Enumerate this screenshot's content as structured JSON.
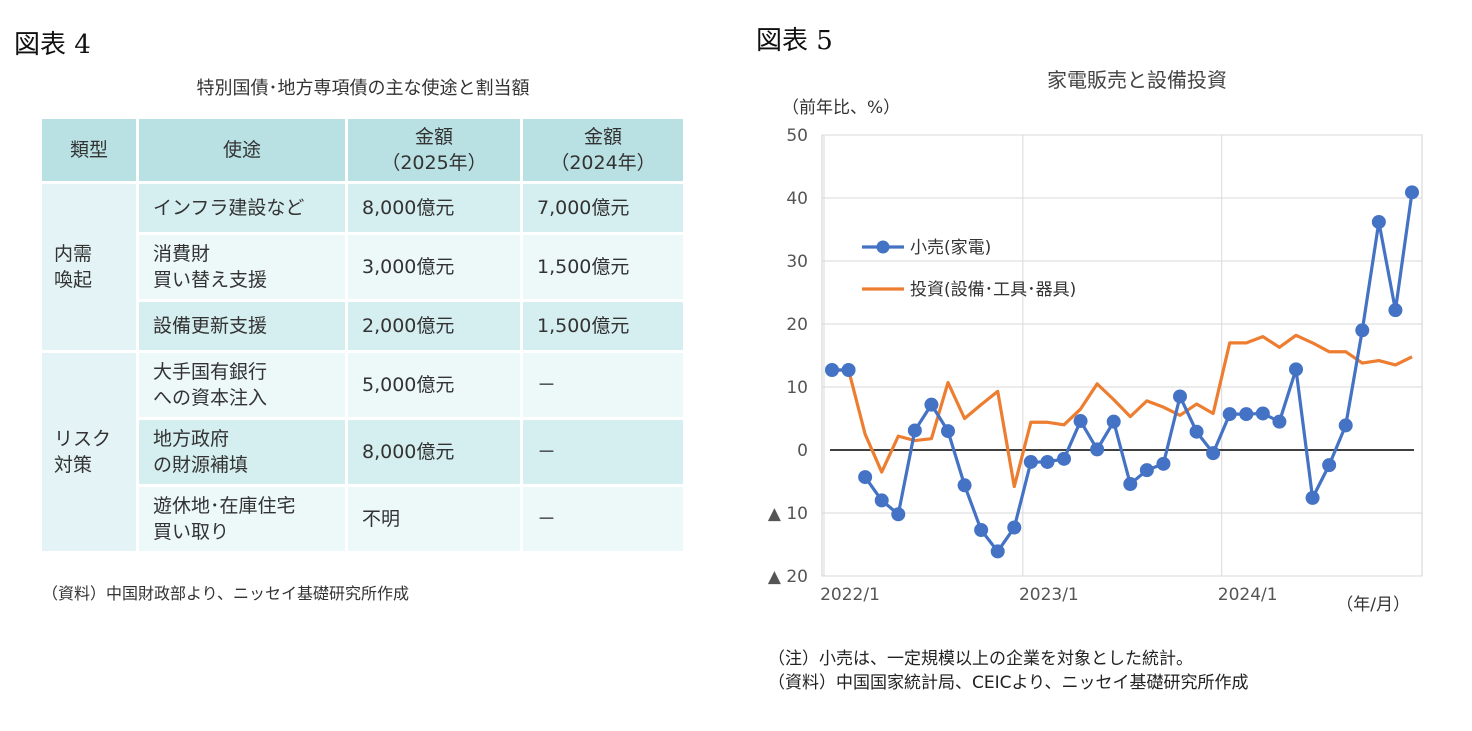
{
  "figure4": {
    "label": "図表 4",
    "title": "特別国債･地方専項債の主な使途と割当額",
    "headers": {
      "type": "類型",
      "use": "使途",
      "amount_2025": "金額\n（2025年）",
      "amount_2024": "金額\n（2024年）"
    },
    "categories": [
      {
        "name": "内需\n喚起",
        "rows": [
          {
            "use": "インフラ建設など",
            "amount_2025": "8,000億元",
            "amount_2024": "7,000億元"
          },
          {
            "use": "消費財\n買い替え支援",
            "amount_2025": "3,000億元",
            "amount_2024": "1,500億元"
          },
          {
            "use": "設備更新支援",
            "amount_2025": "2,000億元",
            "amount_2024": "1,500億元"
          }
        ]
      },
      {
        "name": "リスク\n対策",
        "rows": [
          {
            "use": "大手国有銀行\nへの資本注入",
            "amount_2025": "5,000億元",
            "amount_2024": "－"
          },
          {
            "use": "地方政府\nの財源補填",
            "amount_2025": "8,000億元",
            "amount_2024": "－"
          },
          {
            "use": "遊休地･在庫住宅\n買い取り",
            "amount_2025": "不明",
            "amount_2024": "－"
          }
        ]
      }
    ],
    "source": "（資料）中国財政部より、ニッセイ基礎研究所作成"
  },
  "figure5": {
    "label": "図表 5",
    "notes": [
      "（注）小売は、一定規模以上の企業を対象とした統計。",
      "（資料）中国国家統計局、CEICより、ニッセイ基礎研究所作成"
    ]
  },
  "chart_data": {
    "type": "line",
    "title": "家電販売と設備投資",
    "ylabel": "（前年比、%）",
    "xlabel": "（年/月）",
    "ylim": [
      -20,
      50
    ],
    "y_ticks": [
      -20,
      -10,
      0,
      10,
      20,
      30,
      40,
      50
    ],
    "y_tick_labels": [
      "▲ 20",
      "▲ 10",
      "0",
      "10",
      "20",
      "30",
      "40",
      "50"
    ],
    "x_tick_labels": [
      "2022/1",
      "2023/1",
      "2024/1"
    ],
    "x_tick_index": [
      0,
      12,
      24
    ],
    "gridlines": true,
    "legend_position": "upper-left inside",
    "zero_line": true,
    "x": [
      "2022/1",
      "2022/2",
      "2022/3",
      "2022/4",
      "2022/5",
      "2022/6",
      "2022/7",
      "2022/8",
      "2022/9",
      "2022/10",
      "2022/11",
      "2022/12",
      "2023/1",
      "2023/2",
      "2023/3",
      "2023/4",
      "2023/5",
      "2023/6",
      "2023/7",
      "2023/8",
      "2023/9",
      "2023/10",
      "2023/11",
      "2023/12",
      "2024/1",
      "2024/2",
      "2024/3",
      "2024/4",
      "2024/5",
      "2024/6",
      "2024/7",
      "2024/8",
      "2024/9",
      "2024/10",
      "2024/11",
      "2024/12"
    ],
    "series": [
      {
        "name": "小売(家電)",
        "color": "#4472c4",
        "markers": true,
        "values": [
          12.7,
          12.7,
          -4.3,
          -8.0,
          -10.2,
          3.1,
          7.2,
          3.0,
          -5.6,
          -12.7,
          -16.1,
          -12.3,
          -1.9,
          -1.9,
          -1.4,
          4.6,
          0.1,
          4.5,
          -5.4,
          -3.2,
          -2.2,
          8.5,
          2.9,
          -0.5,
          5.7,
          5.7,
          5.8,
          4.5,
          12.8,
          -7.6,
          -2.4,
          3.9,
          19.0,
          36.2,
          22.2,
          40.9
        ],
        "segments": [
          [
            0,
            1
          ],
          [
            2,
            35
          ]
        ]
      },
      {
        "name": "投資(設備･工具･器具)",
        "color": "#ed7d31",
        "markers": false,
        "values": [
          12.7,
          12.7,
          2.5,
          -3.5,
          2.2,
          1.5,
          1.8,
          10.7,
          5.0,
          7.2,
          9.3,
          -5.8,
          4.4,
          4.4,
          4.0,
          6.5,
          10.5,
          8.0,
          5.3,
          7.8,
          6.8,
          5.5,
          7.3,
          5.8,
          17.0,
          17.0,
          18.0,
          16.3,
          18.2,
          17.0,
          15.6,
          15.6,
          13.8,
          14.2,
          13.5,
          14.8
        ],
        "segments": [
          [
            0,
            35
          ]
        ]
      }
    ]
  }
}
